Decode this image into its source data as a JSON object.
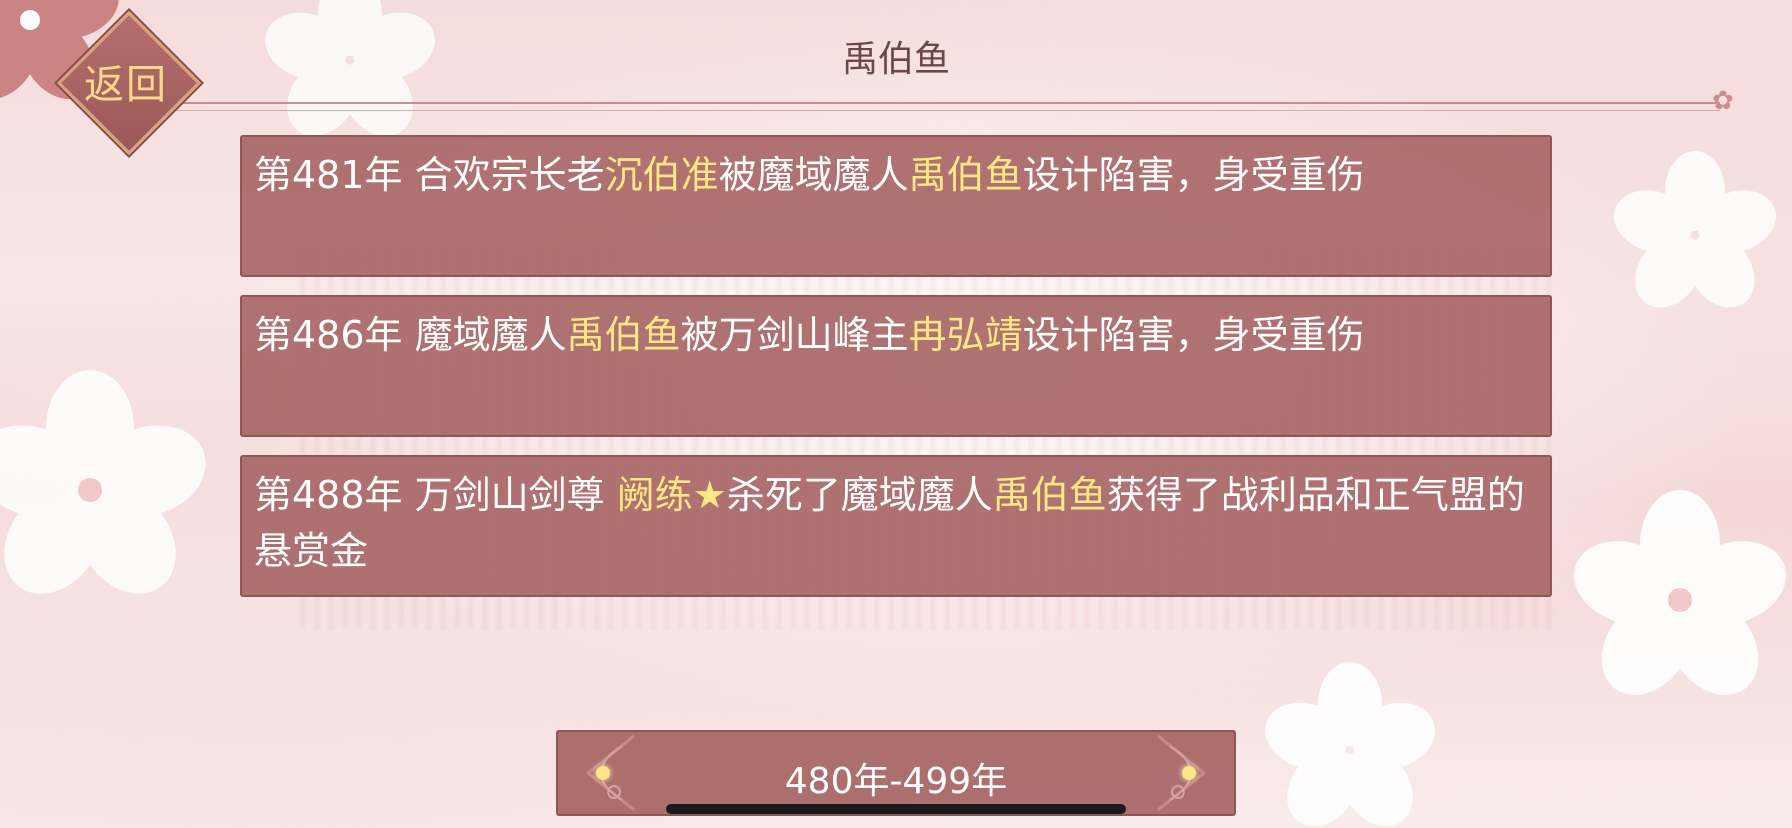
{
  "header": {
    "title": "禹伯鱼",
    "back_label": "返回"
  },
  "events": [
    {
      "segments": [
        {
          "text": "第481年 合欢宗长老",
          "highlight": false
        },
        {
          "text": "沉伯准",
          "highlight": true
        },
        {
          "text": "被魔域魔人",
          "highlight": false
        },
        {
          "text": "禹伯鱼",
          "highlight": true
        },
        {
          "text": "设计陷害，身受重伤",
          "highlight": false
        }
      ]
    },
    {
      "segments": [
        {
          "text": "第486年 魔域魔人",
          "highlight": false
        },
        {
          "text": "禹伯鱼",
          "highlight": true
        },
        {
          "text": "被万剑山峰主",
          "highlight": false
        },
        {
          "text": "冉弘靖",
          "highlight": true
        },
        {
          "text": "设计陷害，身受重伤",
          "highlight": false
        }
      ]
    },
    {
      "segments": [
        {
          "text": "第488年 万剑山剑尊 ",
          "highlight": false
        },
        {
          "text": "阙练★",
          "highlight": true
        },
        {
          "text": "杀死了魔域魔人",
          "highlight": false
        },
        {
          "text": "禹伯鱼",
          "highlight": true
        },
        {
          "text": "获得了战利品和正气盟的悬赏金",
          "highlight": false
        }
      ]
    }
  ],
  "period": {
    "label": "480年-499年",
    "prev_icon": "ornate-left-arrow-icon",
    "next_icon": "ornate-right-arrow-icon"
  },
  "colors": {
    "card_bg": "#a66464",
    "highlight": "#ffe784",
    "back_text": "#ffd98a",
    "title_text": "#6a4848"
  }
}
